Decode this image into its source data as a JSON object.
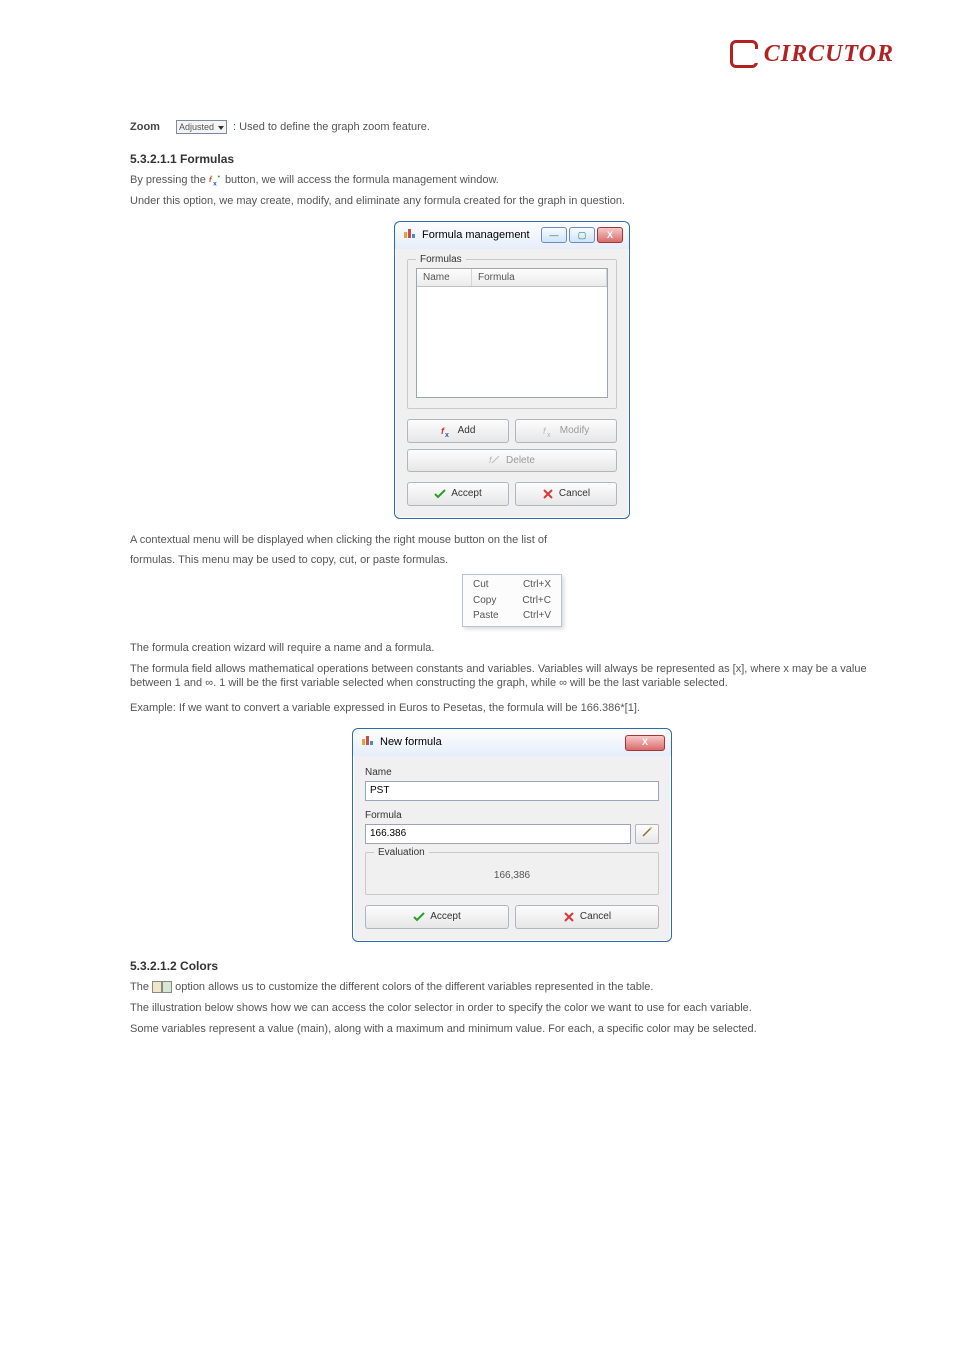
{
  "brand": {
    "name": "CIRCUTOR"
  },
  "intro": {
    "zoom_label": "Zoom",
    "zoom_widget_text": "Adjusted",
    "zoom_desc": ": Used to define the graph zoom feature.",
    "formulas_heading": "5.3.2.1.1 Formulas",
    "formulas_sentence_prefix": "By pressing the ",
    "formulas_sentence_suffix": " button, we will access the formula management window.",
    "formulas_desc": "Under this option, we may create, modify, and eliminate any formula created for the graph in question."
  },
  "dlg_formulas": {
    "title": "Formula management",
    "group": "Formulas",
    "col_name": "Name",
    "col_formula": "Formula",
    "btn_add": "Add",
    "btn_modify": "Modify",
    "btn_delete": "Delete",
    "btn_accept": "Accept",
    "btn_cancel": "Cancel"
  },
  "context_note": {
    "line1": "A contextual menu will be displayed when clicking the right mouse button on the list of",
    "line2": "formulas. This menu may be used to copy, cut, or paste formulas."
  },
  "ctxmenu": {
    "items": [
      {
        "label": "Cut",
        "shortcut": "Ctrl+X"
      },
      {
        "label": "Copy",
        "shortcut": "Ctrl+C"
      },
      {
        "label": "Paste",
        "shortcut": "Ctrl+V"
      }
    ]
  },
  "formula_para": {
    "p1": "The formula creation wizard will require a name and a formula.",
    "p2": "The formula field allows mathematical operations between constants and variables. Variables will always be represented as [x], where x may be a value between 1 and ∞. 1 will be the first variable selected when constructing the graph, while ∞ will be the last variable selected.",
    "p3": "Example: If we want to convert a variable expressed in Euros to Pesetas, the formula will be 166.386*[1]."
  },
  "dlg_new": {
    "title": "New formula",
    "name_label": "Name",
    "name_value": "PST",
    "formula_label": "Formula",
    "formula_value": "166.386",
    "eval_group": "Evaluation",
    "eval_value": "166,386",
    "btn_accept": "Accept",
    "btn_cancel": "Cancel"
  },
  "colors_section": {
    "heading": "5.3.2.1.2 Colors",
    "para_prefix": "The ",
    "para_suffix": " option allows us to customize the different colors of the different variables represented in the table.",
    "p2": "The illustration below shows how we can access the color selector in order to specify the color we want to use for each variable.",
    "p3": "Some variables represent a value (main), along with a maximum and minimum value. For each, a specific color may be selected."
  }
}
